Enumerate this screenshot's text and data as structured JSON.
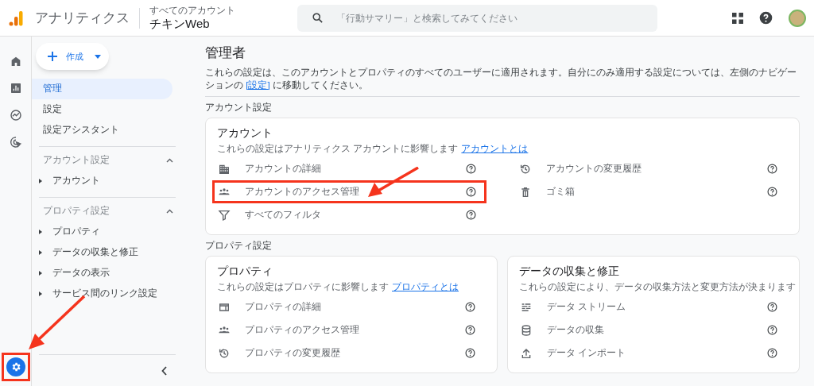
{
  "header": {
    "product": "アナリティクス",
    "account_caption": "すべてのアカウント",
    "property_name": "チキンWeb",
    "search": {
      "placeholder": "「行動サマリー」と検索してみてください"
    }
  },
  "rail": {
    "items": [
      {
        "kind": "home",
        "selected": false
      },
      {
        "kind": "reports",
        "selected": false
      },
      {
        "kind": "explore",
        "selected": false
      },
      {
        "kind": "advertising",
        "selected": false
      }
    ],
    "admin": {
      "selected": true,
      "highlighted": true
    }
  },
  "sidebar": {
    "create_button": "作成",
    "items": [
      {
        "label": "管理",
        "selected": true
      },
      {
        "label": "設定",
        "selected": false
      },
      {
        "label": "設定アシスタント",
        "selected": false
      }
    ],
    "sections": [
      {
        "title": "アカウント設定",
        "expanded": true,
        "children": [
          {
            "label": "アカウント"
          }
        ]
      },
      {
        "title": "プロパティ設定",
        "expanded": true,
        "children": [
          {
            "label": "プロパティ"
          },
          {
            "label": "データの収集と修正"
          },
          {
            "label": "データの表示"
          },
          {
            "label": "サービス間のリンク設定"
          }
        ]
      }
    ]
  },
  "main": {
    "title": "管理者",
    "description": {
      "before": "これらの設定は、このアカウントとプロパティのすべてのユーザーに適用されます。自分にのみ適用する設定については、左側のナビゲーションの ",
      "link": "[設定]",
      "after": " に移動してください。"
    },
    "account_section": {
      "label": "アカウント設定",
      "card": {
        "title": "アカウント",
        "subtitle": "これらの設定はアナリティクス アカウントに影響します",
        "link": "アカウントとは",
        "columns": [
          [
            {
              "kind": "building",
              "label": "アカウントの詳細",
              "highlighted": false
            },
            {
              "kind": "people",
              "label": "アカウントのアクセス管理",
              "highlighted": true
            },
            {
              "kind": "filter",
              "label": "すべてのフィルタ",
              "highlighted": false
            }
          ],
          [
            {
              "kind": "history",
              "label": "アカウントの変更履歴",
              "highlighted": false
            },
            {
              "kind": "trash",
              "label": "ゴミ箱",
              "highlighted": false
            }
          ]
        ]
      }
    },
    "property_section": {
      "label": "プロパティ設定",
      "cards": [
        {
          "title": "プロパティ",
          "subtitle": "これらの設定はプロパティに影響します",
          "link": "プロパティとは",
          "items": [
            {
              "kind": "card",
              "label": "プロパティの詳細",
              "highlighted": false
            },
            {
              "kind": "people",
              "label": "プロパティのアクセス管理",
              "highlighted": false
            },
            {
              "kind": "history",
              "label": "プロパティの変更履歴",
              "highlighted": false
            }
          ]
        },
        {
          "title": "データの収集と修正",
          "subtitle": "これらの設定により、データの収集方法と変更方法が決まります",
          "items": [
            {
              "kind": "stream",
              "label": "データ ストリーム",
              "highlighted": false
            },
            {
              "kind": "database",
              "label": "データの収集",
              "highlighted": false
            },
            {
              "kind": "upload",
              "label": "データ インポート",
              "highlighted": false
            }
          ]
        }
      ]
    }
  }
}
